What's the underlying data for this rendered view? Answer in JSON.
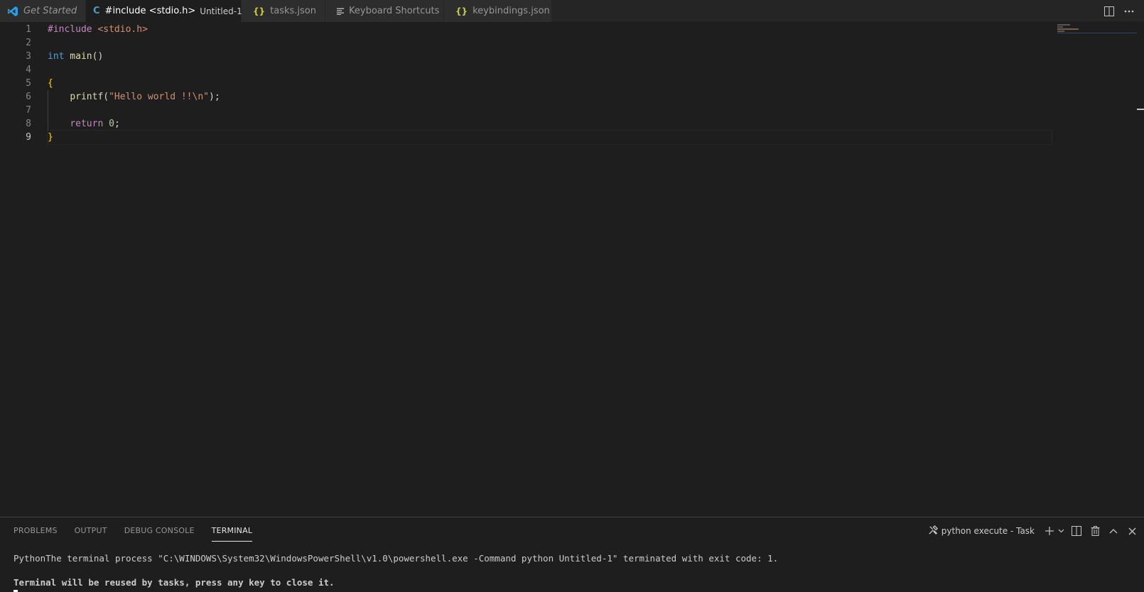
{
  "tabs": [
    {
      "label": "Get Started",
      "icon": "vscode-logo-icon"
    },
    {
      "label": "#include <stdio.h>",
      "description": "Untitled-1",
      "icon": "c-file-icon",
      "icon_text": "C",
      "active": true,
      "dirty": true
    },
    {
      "label": "tasks.json",
      "icon": "json-file-icon",
      "icon_text": "{}"
    },
    {
      "label": "Keyboard Shortcuts",
      "icon": "keyboard-shortcuts-icon"
    },
    {
      "label": "keybindings.json",
      "icon": "json-file-icon",
      "icon_text": "{}"
    }
  ],
  "tab_actions": [
    "split-editor-icon",
    "more-actions-icon"
  ],
  "editor": {
    "line_numbers": [
      "1",
      "2",
      "3",
      "4",
      "5",
      "6",
      "7",
      "8",
      "9"
    ],
    "current_line": 9,
    "lines": {
      "l1_pre": "#include",
      "l1_str": " <stdio.h>",
      "l3_type": "int",
      "l3_fn": " main",
      "l3_rest": "()",
      "l5": "{",
      "l6_fn": "printf",
      "l6_open": "(",
      "l6_str": "\"Hello world !!\\n\"",
      "l6_close": ");",
      "l8_kw": "return",
      "l8_num": "0",
      "l8_end": ";",
      "l9": "}"
    }
  },
  "panel": {
    "tabs": [
      "PROBLEMS",
      "OUTPUT",
      "DEBUG CONSOLE",
      "TERMINAL"
    ],
    "active_tab": "TERMINAL",
    "task_label": "python execute - Task",
    "terminal_lines": [
      "PythonThe terminal process \"C:\\WINDOWS\\System32\\WindowsPowerShell\\v1.0\\powershell.exe -Command python Untitled-1\" terminated with exit code: 1.",
      "",
      "Terminal will be reused by tasks, press any key to close it."
    ]
  },
  "colors": {
    "accent": "#007acc",
    "keyword": "#569cd6",
    "control": "#c586c0",
    "string": "#ce9178",
    "function": "#dcdcaa",
    "number": "#b5cea8",
    "c_icon": "#519aba",
    "json_icon": "#cbcb41"
  }
}
